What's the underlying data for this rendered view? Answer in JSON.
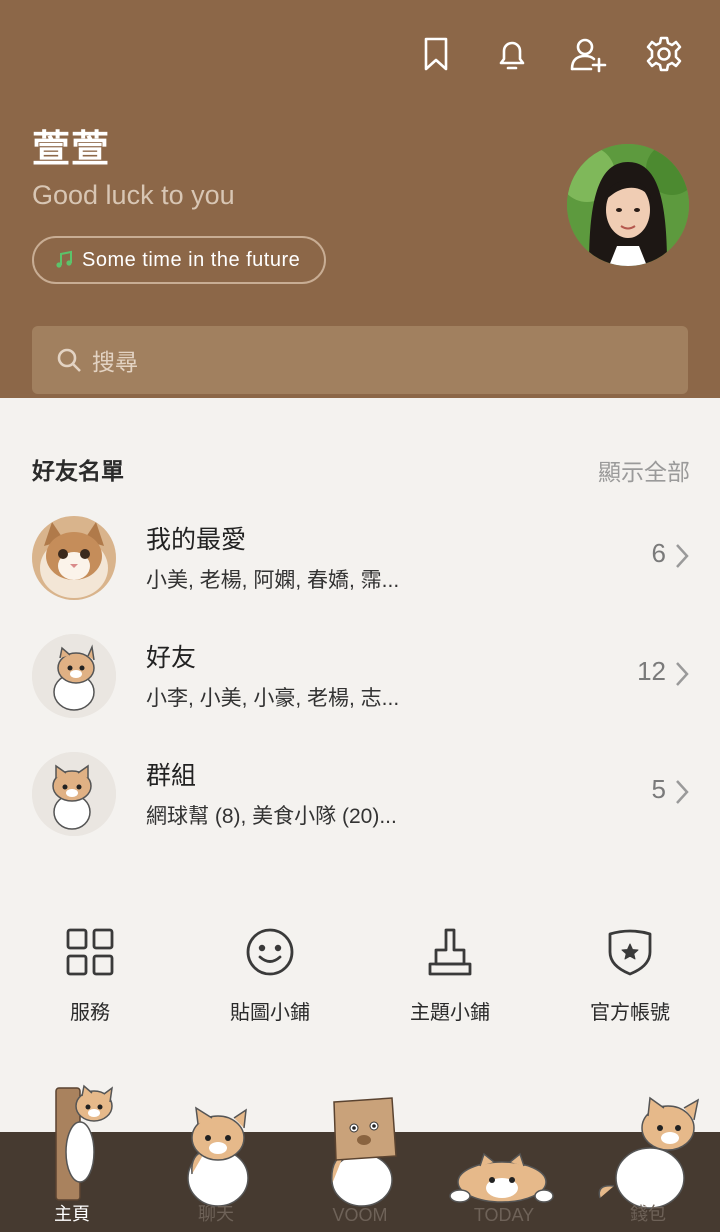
{
  "header": {
    "icons": [
      "bookmark-icon",
      "bell-icon",
      "add-friend-icon",
      "gear-icon"
    ],
    "background_color": "#8c6748"
  },
  "profile": {
    "name": "萱萱",
    "status_message": "Good luck to you",
    "music": "Some time in the future"
  },
  "search": {
    "placeholder": "搜尋"
  },
  "friends": {
    "title": "好友名單",
    "show_all": "顯示全部",
    "rows": [
      {
        "title": "我的最愛",
        "subtitle": "小美, 老楊, 阿嫻, 春嬌, 霈...",
        "count": "6"
      },
      {
        "title": "好友",
        "subtitle": "小李, 小美, 小豪, 老楊, 志...",
        "count": "12"
      },
      {
        "title": "群組",
        "subtitle": "網球幫 (8), 美食小隊 (20)...",
        "count": "5"
      }
    ]
  },
  "services": [
    {
      "label": "服務",
      "icon": "grid-icon"
    },
    {
      "label": "貼圖小鋪",
      "icon": "smiley-icon"
    },
    {
      "label": "主題小鋪",
      "icon": "brush-icon"
    },
    {
      "label": "官方帳號",
      "icon": "shield-star-icon"
    }
  ],
  "bottom_nav": {
    "items": [
      {
        "label": "主頁",
        "active": true
      },
      {
        "label": "聊天",
        "active": false
      },
      {
        "label": "VOOM",
        "active": false
      },
      {
        "label": "TODAY",
        "active": false
      },
      {
        "label": "錢包",
        "active": false
      }
    ],
    "background_color": "#463a30"
  }
}
